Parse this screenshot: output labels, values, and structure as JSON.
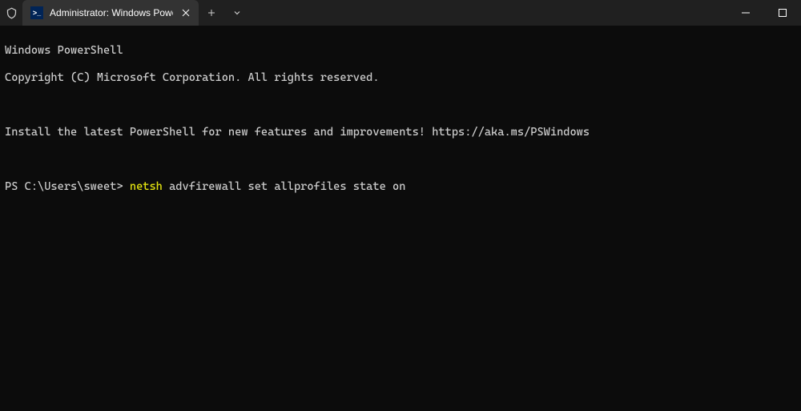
{
  "titlebar": {
    "tab_title": "Administrator: Windows Powe",
    "tab_icon_text": ">_"
  },
  "terminal": {
    "line1": "Windows PowerShell",
    "line2": "Copyright (C) Microsoft Corporation. All rights reserved.",
    "line3": "Install the latest PowerShell for new features and improvements! https://aka.ms/PSWindows",
    "prompt": "PS C:\\Users\\sweet> ",
    "cmd_highlight": "netsh",
    "cmd_rest": " advfirewall set allprofiles state on"
  }
}
